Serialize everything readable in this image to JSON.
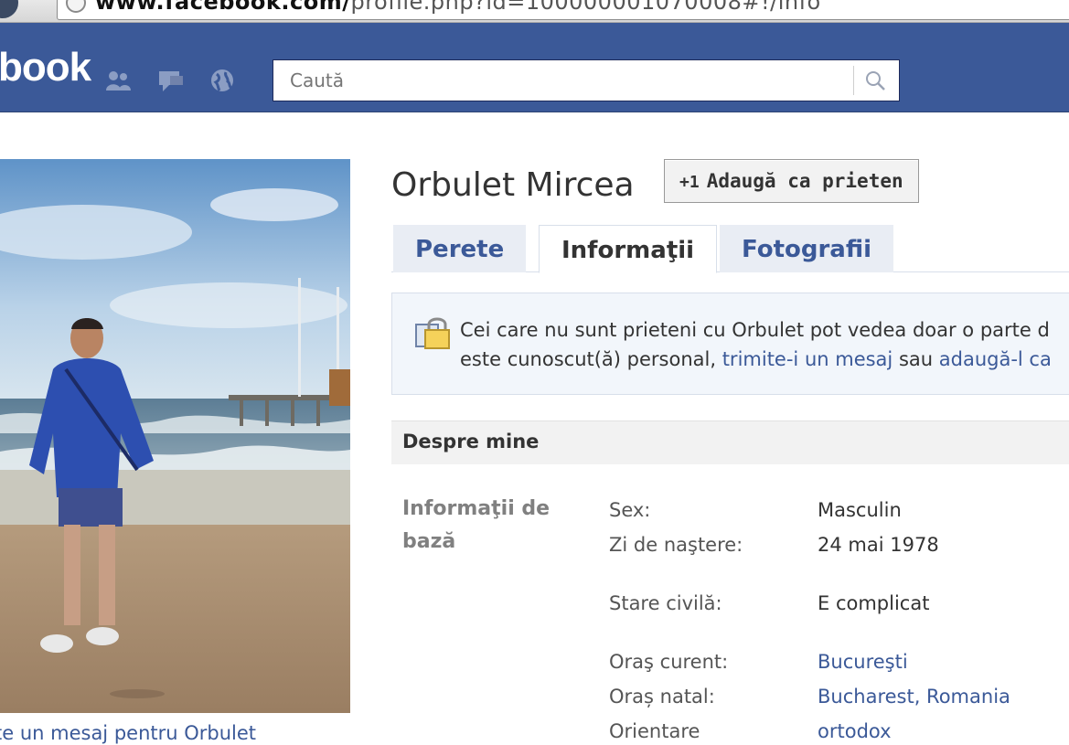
{
  "browser": {
    "address_domain": "www.facebook.com/",
    "address_path": "profile.php?id=100000001070008#!/info"
  },
  "header": {
    "logo": "book",
    "search_placeholder": "Caută"
  },
  "profile": {
    "name": "Orbulet Mircea",
    "add_friend_label": "Adaugă ca prieten",
    "add_friend_prefix": "+1",
    "photo_caption": "te un mesaj pentru Orbulet"
  },
  "tabs": [
    {
      "label": "Perete",
      "active": false
    },
    {
      "label": "Informaţii",
      "active": true
    },
    {
      "label": "Fotografii",
      "active": false
    }
  ],
  "notice": {
    "line1": "Cei care nu sunt prieteni cu Orbulet pot vedea doar o parte d",
    "line2_prefix": "este cunoscut(ă) personal, ",
    "link_message": "trimite-i un mesaj",
    "middle": " sau ",
    "link_add": "adaugă-l ca"
  },
  "about": {
    "section_title": "Despre mine",
    "basic_info_line1": "Informaţii de",
    "basic_info_line2": "bază",
    "fields": [
      {
        "label": "Sex:",
        "value": "Masculin",
        "link": false
      },
      {
        "label": "Zi de naştere:",
        "value": "24 mai 1978",
        "link": false
      },
      {
        "label": "Stare civilă:",
        "value": "E complicat",
        "link": false
      },
      {
        "label": "Oraş curent:",
        "value": "Bucureşti",
        "link": true
      },
      {
        "label": "Oraș natal:",
        "value": "Bucharest, Romania",
        "link": true
      },
      {
        "label": "Orientare",
        "value": "ortodox",
        "link": true
      }
    ]
  },
  "colors": {
    "brand_blue": "#3b5998",
    "link_blue": "#3b5998"
  }
}
